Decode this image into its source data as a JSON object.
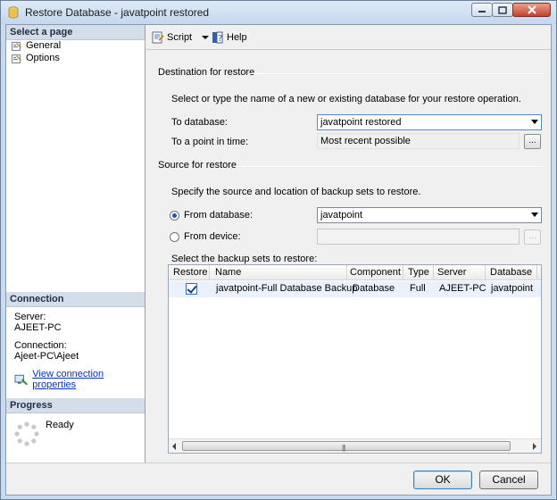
{
  "window": {
    "title": "Restore Database - javatpoint restored"
  },
  "left": {
    "select_page_header": "Select a page",
    "pages": [
      {
        "label": "General",
        "icon": "wrench-page-icon"
      },
      {
        "label": "Options",
        "icon": "wrench-page-icon"
      }
    ],
    "connection_header": "Connection",
    "server_label": "Server:",
    "server_value": "AJEET-PC",
    "connection_label": "Connection:",
    "connection_value": "Ajeet-PC\\Ajeet",
    "view_connection_link": "View connection properties",
    "progress_header": "Progress",
    "progress_status": "Ready"
  },
  "toolbar": {
    "script_label": "Script",
    "help_label": "Help"
  },
  "destination": {
    "group_title": "Destination for restore",
    "description": "Select or type the name of a new or existing database for your restore operation.",
    "to_database_label": "To database:",
    "to_database_value": "javatpoint restored",
    "to_point_label": "To a point in time:",
    "to_point_value": "Most recent possible"
  },
  "source": {
    "group_title": "Source for restore",
    "description": "Specify the source and location of backup sets to restore.",
    "from_database_label": "From database:",
    "from_database_value": "javatpoint",
    "from_device_label": "From device:",
    "selected_option": "From database",
    "backup_sets_label": "Select the backup sets to restore:",
    "ellipsis_label": "..."
  },
  "grid": {
    "columns": [
      "Restore",
      "Name",
      "Component",
      "Type",
      "Server",
      "Database"
    ],
    "rows": [
      {
        "restore": true,
        "name": "javatpoint-Full Database Backup",
        "component": "Database",
        "type": "Full",
        "server": "AJEET-PC",
        "database": "javatpoint"
      }
    ]
  },
  "buttons": {
    "ok": "OK",
    "cancel": "Cancel"
  },
  "colors": {
    "accent": "#1a58b5",
    "section_header_bg": "#d4deea",
    "link": "#0033cc"
  }
}
